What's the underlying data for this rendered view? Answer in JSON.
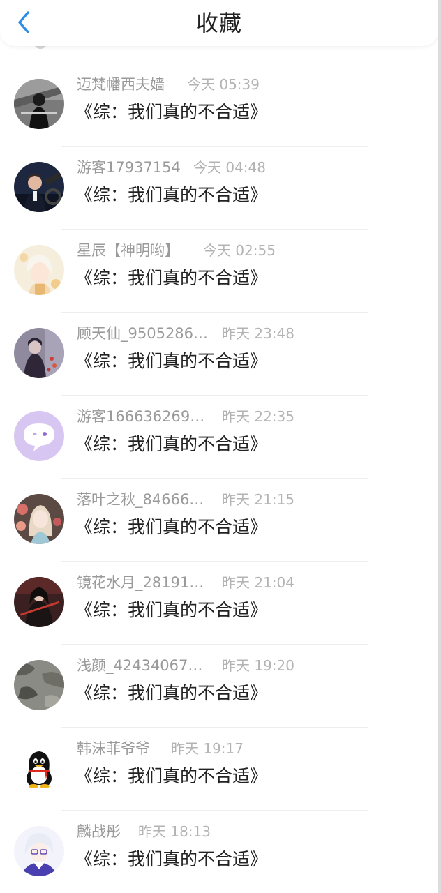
{
  "header": {
    "title": "收藏",
    "back_icon": "chevron-left-icon",
    "accent_color": "#2b8de8"
  },
  "feed": [
    {
      "username": "迈梵幡西夫嫱",
      "time": "今天 05:39",
      "book": "《综：我们真的不合适》",
      "avatar": "dark-portrait-avatar"
    },
    {
      "username": "游客17937154",
      "time": "今天 04:48",
      "book": "《综：我们真的不合适》",
      "avatar": "man-driving-avatar"
    },
    {
      "username": "星辰【神明哟】",
      "time": "今天 02:55",
      "book": "《综：我们真的不合适》",
      "avatar": "anime-white-hair-avatar"
    },
    {
      "username": "顾天仙_9505286…",
      "time": "昨天 23:48",
      "book": "《综：我们真的不合适》",
      "avatar": "anime-dark-scene-avatar"
    },
    {
      "username": "游客166636269…",
      "time": "昨天 22:35",
      "book": "《综：我们真的不合适》",
      "avatar": "purple-chat-bubble-avatar"
    },
    {
      "username": "落叶之秋_84666…",
      "time": "昨天 21:15",
      "book": "《综：我们真的不合适》",
      "avatar": "anime-girl-flowers-avatar"
    },
    {
      "username": "镜花水月_28191…",
      "time": "昨天 21:04",
      "book": "《综：我们真的不合适》",
      "avatar": "anime-swordsman-avatar"
    },
    {
      "username": "浅颜_42434067…",
      "time": "昨天 19:20",
      "book": "《综：我们真的不合适》",
      "avatar": "camouflage-avatar"
    },
    {
      "username": "韩沫菲爷爷",
      "time": "昨天 19:17",
      "book": "《综：我们真的不合适》",
      "avatar": "qq-penguin-avatar"
    },
    {
      "username": "麟战彤",
      "time": "昨天 18:13",
      "book": "《综：我们真的不合适》",
      "avatar": "anime-glasses-boy-avatar"
    }
  ]
}
